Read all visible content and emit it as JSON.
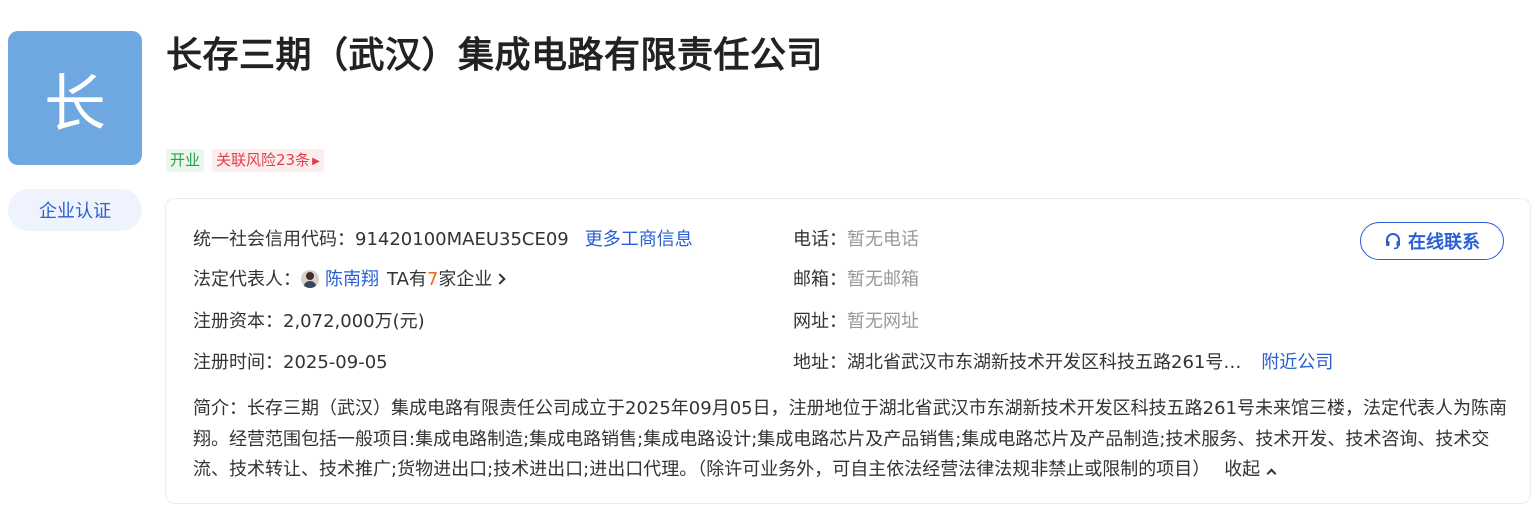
{
  "company": {
    "logo_char": "长",
    "name": "长存三期（武汉）集成电路有限责任公司",
    "cert_label": "企业认证"
  },
  "tags": {
    "status": "开业",
    "risk": "关联风险23条"
  },
  "info": {
    "credit_code_label": "统一社会信用代码：",
    "credit_code_value": "91420100MAEU35CE09",
    "more_info_link": "更多工商信息",
    "legal_rep_label": "法定代表人：",
    "legal_rep_name": "陈南翔",
    "legal_rep_ta_prefix": "TA有",
    "legal_rep_count": "7",
    "legal_rep_ta_suffix": "家企业",
    "capital_label": "注册资本：",
    "capital_value": "2,072,000万(元)",
    "reg_time_label": "注册时间：",
    "reg_time_value": "2025-09-05",
    "phone_label": "电话：",
    "phone_value": "暂无电话",
    "email_label": "邮箱：",
    "email_value": "暂无邮箱",
    "website_label": "网址：",
    "website_value": "暂无网址",
    "address_label": "地址：",
    "address_value": "湖北省武汉市东湖新技术开发区科技五路261号…",
    "nearby_link": "附近公司"
  },
  "contact_button": "在线联系",
  "intro": {
    "text": "简介：长存三期（武汉）集成电路有限责任公司成立于2025年09月05日，注册地位于湖北省武汉市东湖新技术开发区科技五路261号未来馆三楼，法定代表人为陈南翔。经营范围包括一般项目:集成电路制造;集成电路销售;集成电路设计;集成电路芯片及产品销售;集成电路芯片及产品制造;技术服务、技术开发、技术咨询、技术交流、技术转让、技术推广;货物进出口;技术进出口;进出口代理。（除许可业务外，可自主依法经营法律法规非禁止或限制的项目）",
    "collapse_label": "收起"
  },
  "colors": {
    "accent": "#2a5fd3",
    "logo_bg": "#6fa8e0",
    "status_green": "#2e9d4e",
    "risk_red": "#e0404c",
    "count_orange": "#f06a28"
  },
  "icons": [
    "headset-icon",
    "chevron-right-icon",
    "chevron-up-icon",
    "caret-right-icon"
  ]
}
